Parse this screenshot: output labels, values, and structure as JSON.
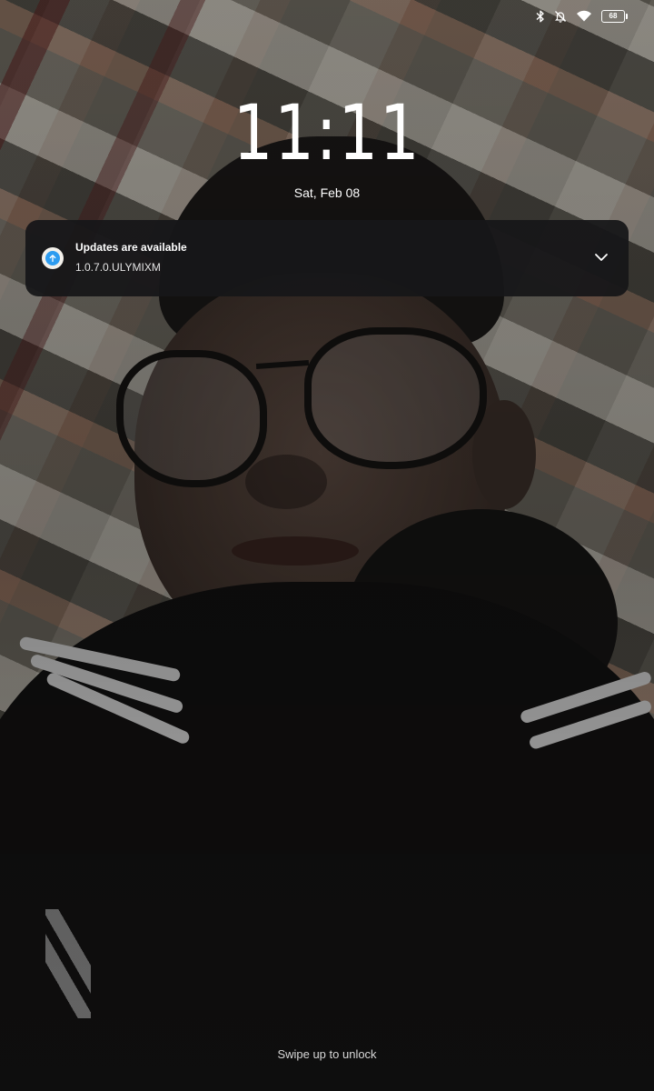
{
  "status_bar": {
    "icons": [
      "bluetooth-icon",
      "bell-muted-icon",
      "wifi-icon"
    ],
    "battery_level": "68"
  },
  "lock_screen": {
    "time": "11:11",
    "date": "Sat, Feb 08",
    "unlock_hint": "Swipe up to unlock"
  },
  "notification": {
    "app_icon": "system-update-icon",
    "title": "Updates are available",
    "body": "1.0.7.0.ULYMIXM",
    "expand_icon": "chevron-down-icon",
    "accent_color": "#2d9cf0"
  }
}
